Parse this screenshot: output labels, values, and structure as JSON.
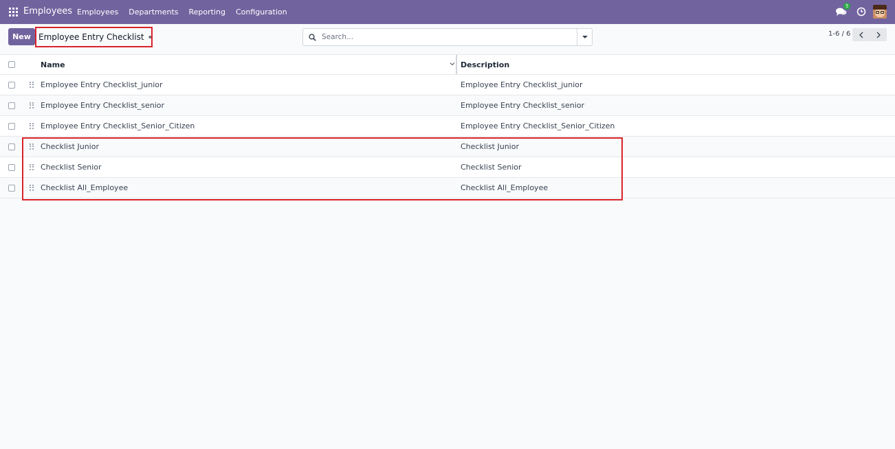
{
  "navbar": {
    "app_name": "Employees",
    "menu": [
      "Employees",
      "Departments",
      "Reporting",
      "Configuration"
    ],
    "chat_badge": "5",
    "accent_color": "#71639e"
  },
  "control_panel": {
    "new_label": "New",
    "breadcrumb_title": "Employee Entry Checklist",
    "search_placeholder": "Search...",
    "pager": "1-6 / 6"
  },
  "table": {
    "columns": [
      "Name",
      "Description"
    ],
    "rows": [
      {
        "name": "Employee Entry Checklist_junior",
        "description": "Employee Entry Checklist_junior"
      },
      {
        "name": "Employee Entry Checklist_senior",
        "description": "Employee Entry Checklist_senior"
      },
      {
        "name": "Employee Entry Checklist_Senior_Citizen",
        "description": "Employee Entry Checklist_Senior_Citizen"
      },
      {
        "name": "Checklist Junior",
        "description": "Checklist Junior"
      },
      {
        "name": "Checklist Senior",
        "description": "Checklist Senior"
      },
      {
        "name": "Checklist All_Employee",
        "description": "Checklist All_Employee"
      }
    ]
  },
  "highlight_color": "#d9232a"
}
